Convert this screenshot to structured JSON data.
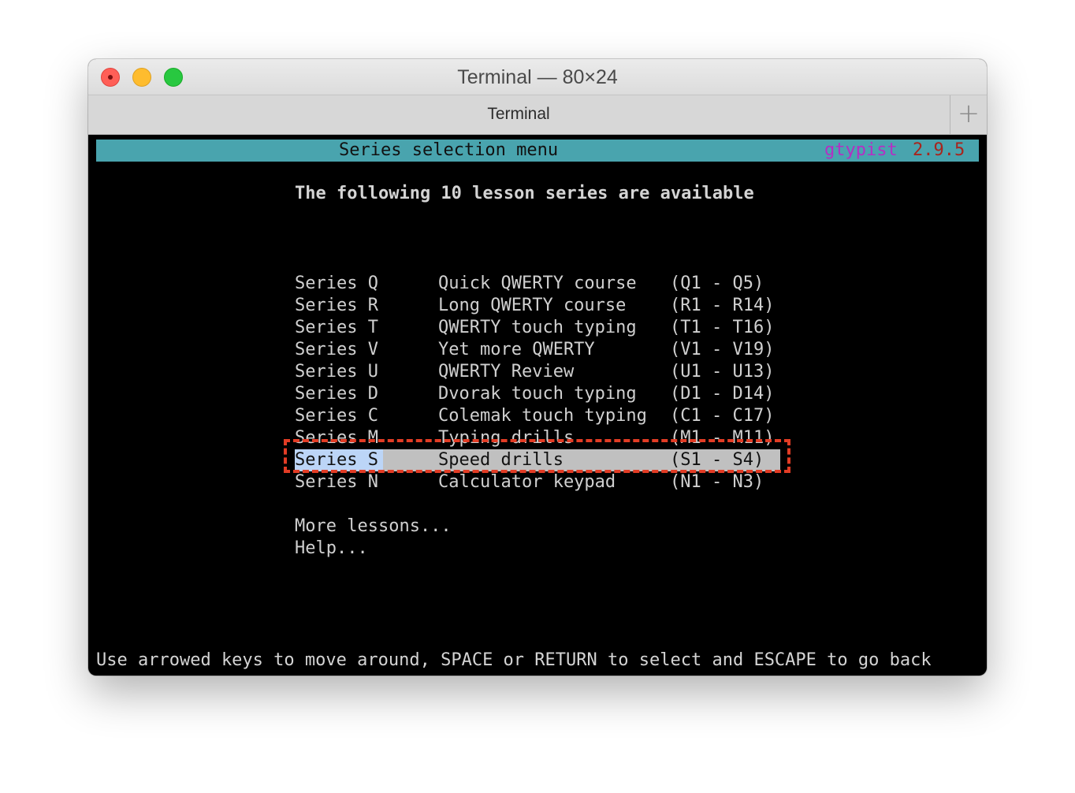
{
  "window": {
    "title": "Terminal — 80×24",
    "tab_label": "Terminal",
    "new_tab_glyph": "+"
  },
  "terminal": {
    "header_title": "Series selection menu",
    "app_name": "gtypist",
    "app_version": "2.9.5",
    "subtitle": "The following 10 lesson series are available",
    "menu_items": [
      {
        "series": "Series Q",
        "description": "Quick QWERTY course",
        "range": "(Q1 - Q5)"
      },
      {
        "series": "Series R",
        "description": "Long QWERTY course",
        "range": "(R1 - R14)"
      },
      {
        "series": "Series T",
        "description": "QWERTY touch typing",
        "range": "(T1 - T16)"
      },
      {
        "series": "Series V",
        "description": "Yet more QWERTY",
        "range": "(V1 - V19)"
      },
      {
        "series": "Series U",
        "description": "QWERTY Review",
        "range": "(U1 - U13)"
      },
      {
        "series": "Series D",
        "description": "Dvorak touch typing",
        "range": "(D1 - D14)"
      },
      {
        "series": "Series C",
        "description": "Colemak touch typing",
        "range": "(C1 - C17)"
      },
      {
        "series": "Series M",
        "description": "Typing drills",
        "range": "(M1 - M11)"
      },
      {
        "series": "Series S",
        "description": "Speed drills",
        "range": "(S1 - S4)",
        "selected": true
      },
      {
        "series": "Series N",
        "description": "Calculator keypad",
        "range": "(N1 - N3)"
      }
    ],
    "more_lessons": "More lessons...",
    "help": "Help...",
    "footer": "Use arrowed keys to move around, SPACE or RETURN to select and ESCAPE to go back"
  },
  "colors": {
    "header_bar": "#49a4ae",
    "app_name": "#b42fc4",
    "app_version": "#a8241c",
    "selection_row": "#c0c0c0",
    "selection_cursor": "#bcd5f7",
    "annotation": "#e23c25"
  }
}
